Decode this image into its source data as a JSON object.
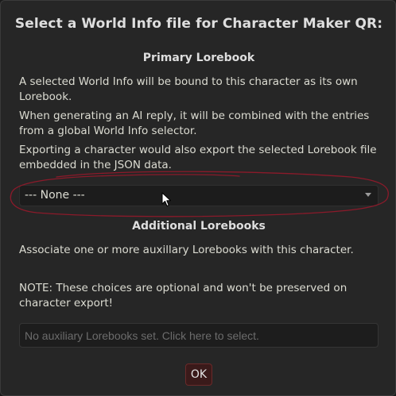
{
  "dialog": {
    "title": "Select a World Info file for Character Maker QR:",
    "primary": {
      "heading": "Primary Lorebook",
      "paragraphs": [
        "A selected World Info will be bound to this character as its own Lorebook.",
        "When generating an AI reply, it will be combined with the entries from a global World Info selector.",
        "Exporting a character would also export the selected Lorebook file embedded in the JSON data."
      ],
      "select_value": "--- None ---"
    },
    "additional": {
      "heading": "Additional Lorebooks",
      "description": "Associate one or more auxillary Lorebooks with this character.",
      "note": "NOTE: These choices are optional and won't be preserved on character export!",
      "placeholder": "No auxiliary Lorebooks set. Click here to select."
    },
    "ok_label": "OK"
  },
  "icons": {
    "dropdown": "chevron-down-icon",
    "cursor": "mouse-pointer-icon"
  },
  "colors": {
    "background": "#262626",
    "annotation": "#8b1a2a",
    "ok_button": "#3a1a1a"
  }
}
